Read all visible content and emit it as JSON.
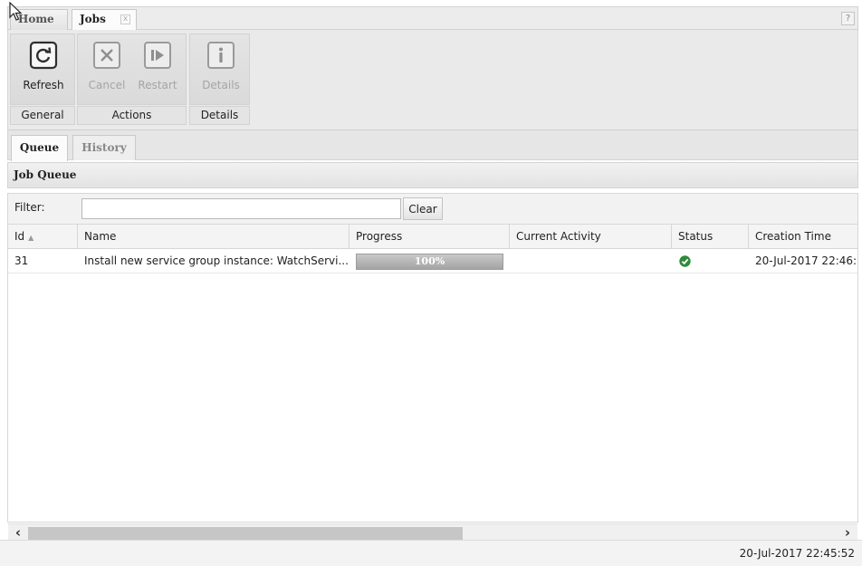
{
  "top_tabs": [
    {
      "label": "Home",
      "active": false
    },
    {
      "label": "Jobs",
      "active": true,
      "closable": true
    }
  ],
  "help_label": "?",
  "close_label": "x",
  "ribbon": {
    "groups": [
      {
        "label": "General",
        "buttons": [
          {
            "label": "Refresh",
            "icon": "refresh-icon",
            "enabled": true
          }
        ]
      },
      {
        "label": "Actions",
        "buttons": [
          {
            "label": "Cancel",
            "icon": "cancel-icon",
            "enabled": false
          },
          {
            "label": "Restart",
            "icon": "restart-icon",
            "enabled": false
          }
        ]
      },
      {
        "label": "Details",
        "buttons": [
          {
            "label": "Details",
            "icon": "info-icon",
            "enabled": false
          }
        ]
      }
    ]
  },
  "sub_tabs": [
    {
      "label": "Queue",
      "active": true
    },
    {
      "label": "History",
      "active": false
    }
  ],
  "panel": {
    "title": "Job Queue",
    "filter": {
      "label": "Filter:",
      "value": "",
      "placeholder": "",
      "clear_label": "Clear"
    },
    "columns": [
      "Id",
      "Name",
      "Progress",
      "Current Activity",
      "Status",
      "Creation Time"
    ],
    "sort": {
      "column": "Id",
      "direction": "ascending"
    },
    "rows": [
      {
        "id": "31",
        "name": "Install new service group instance: WatchServi...",
        "progress": 100,
        "progress_label": "100%",
        "current_activity": "",
        "status": "success",
        "status_icon": "check-circle-icon",
        "creation_time": "20-Jul-2017 22:46:"
      }
    ]
  },
  "status_bar": {
    "time": "20-Jul-2017 22:45:52"
  },
  "colors": {
    "success": "#2e8b3a",
    "progress_fill": "#a9a9a9"
  }
}
